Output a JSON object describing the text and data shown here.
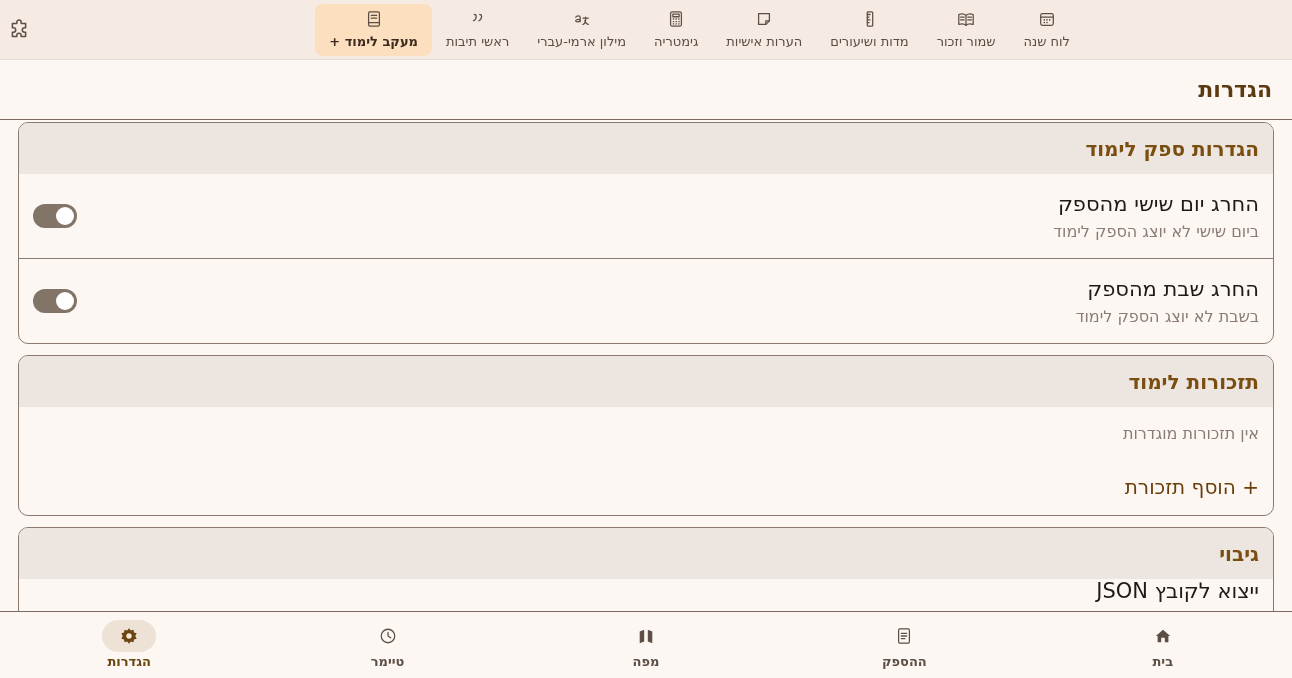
{
  "top_nav": {
    "items": [
      {
        "kind": "calendar",
        "label": "לוח שנה",
        "selected": false
      },
      {
        "kind": "open-book",
        "label": "שמור וזכור",
        "selected": false
      },
      {
        "kind": "ruler",
        "label": "מדות ושיעורים",
        "selected": false
      },
      {
        "kind": "note",
        "label": "הערות אישיות",
        "selected": false
      },
      {
        "kind": "calculator",
        "label": "גימטריה",
        "selected": false
      },
      {
        "kind": "translate",
        "label": "מילון ארמי-עברי",
        "selected": false
      },
      {
        "kind": "quote",
        "label": "ראשי תיבות",
        "selected": false
      },
      {
        "kind": "book",
        "label": "מעקב לימוד +",
        "selected": true
      }
    ]
  },
  "page_title": "הגדרות",
  "sections": [
    {
      "title": "הגדרות ספק לימוד",
      "rows": [
        {
          "kind": "toggle",
          "title": "החרג יום שישי מהספק",
          "subtitle": "ביום שישי לא יוצג הספק לימוד",
          "on": true
        },
        {
          "kind": "toggle",
          "title": "החרג שבת מהספק",
          "subtitle": "בשבת לא יוצג הספק לימוד",
          "on": true
        }
      ]
    },
    {
      "title": "תזכורות לימוד",
      "rows": [
        {
          "kind": "note",
          "text": "אין תזכורות מוגדרות"
        },
        {
          "kind": "add",
          "text": "+ הוסף תזכורת"
        }
      ]
    },
    {
      "title": "גיבוי",
      "rows": [
        {
          "kind": "action",
          "title": "ייצוא לקובץ JSON"
        }
      ]
    }
  ],
  "bottom_nav": {
    "items": [
      {
        "kind": "home",
        "label": "בית",
        "selected": false
      },
      {
        "kind": "document",
        "label": "ההספק",
        "selected": false
      },
      {
        "kind": "map",
        "label": "מפה",
        "selected": false
      },
      {
        "kind": "clock",
        "label": "טיימר",
        "selected": false
      },
      {
        "kind": "gear",
        "label": "הגדרות",
        "selected": true
      }
    ]
  }
}
